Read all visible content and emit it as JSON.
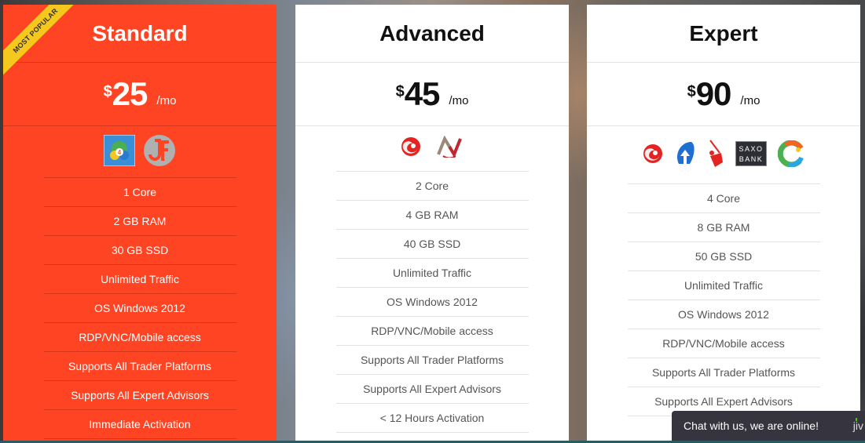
{
  "plans": [
    {
      "name": "Standard",
      "featured": true,
      "badge": "MOST POPULAR",
      "currency": "$",
      "price": "25",
      "period": "/mo",
      "platform_icons": [
        "metatrader4-icon",
        "jforex-icon"
      ],
      "features": [
        "1 Core",
        "2 GB RAM",
        "30 GB SSD",
        "Unlimited Traffic",
        "OS Windows 2012",
        "RDP/VNC/Mobile access",
        "Supports All Trader Platforms",
        "Supports All Expert Advisors",
        "Immediate Activation"
      ]
    },
    {
      "name": "Advanced",
      "featured": false,
      "currency": "$",
      "price": "45",
      "period": "/mo",
      "platform_icons": [
        "ctrader-icon",
        "ninjatrader-icon"
      ],
      "features": [
        "2 Core",
        "4 GB RAM",
        "40 GB SSD",
        "Unlimited Traffic",
        "OS Windows 2012",
        "RDP/VNC/Mobile access",
        "Supports All Trader Platforms",
        "Supports All Expert Advisors",
        "< 12 Hours Activation"
      ]
    },
    {
      "name": "Expert",
      "featured": false,
      "currency": "$",
      "price": "90",
      "period": "/mo",
      "platform_icons": [
        "ctrader-icon",
        "arrow-up-platform-icon",
        "red-figure-platform-icon",
        "saxo-bank-icon",
        "multicolor-c-platform-icon"
      ],
      "saxo_label_top": "SAXO",
      "saxo_label_bottom": "BANK",
      "features": [
        "4 Core",
        "8 GB RAM",
        "50 GB SSD",
        "Unlimited Traffic",
        "OS Windows 2012",
        "RDP/VNC/Mobile access",
        "Supports All Trader Platforms",
        "Supports All Expert Advisors",
        ""
      ]
    }
  ],
  "chat": {
    "label": "Chat with us, we are online!",
    "brand": "jiv"
  },
  "colors": {
    "featured": "#ff4423",
    "ribbon": "#f5c81f",
    "chat_bg": "#36343f"
  }
}
